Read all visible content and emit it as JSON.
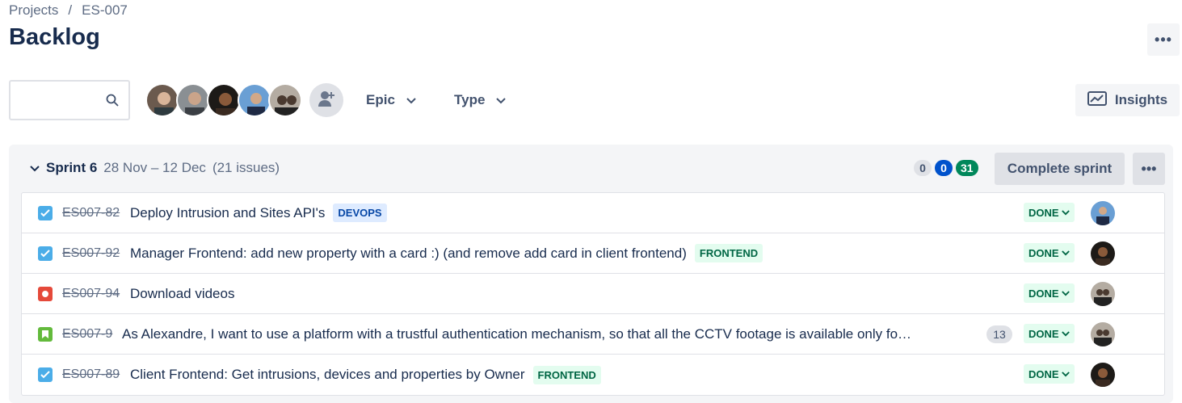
{
  "breadcrumb": {
    "projects": "Projects",
    "separator": "/",
    "project": "ES-007"
  },
  "page": {
    "title": "Backlog"
  },
  "search": {
    "placeholder": ""
  },
  "filters": {
    "epic": "Epic",
    "type": "Type"
  },
  "insights_label": "Insights",
  "sprint": {
    "name": "Sprint 6",
    "dates": "28 Nov – 12 Dec",
    "issue_count": "(21 issues)",
    "counts": {
      "todo": "0",
      "in_progress": "0",
      "done": "31"
    },
    "complete_label": "Complete sprint"
  },
  "issues": [
    {
      "type": "task",
      "key": "ES007-82",
      "summary": "Deploy Intrusion and Sites API's",
      "label": "DEVOPS",
      "status": "DONE"
    },
    {
      "type": "task",
      "key": "ES007-92",
      "summary": "Manager Frontend: add new property with a card :) (and remove add card in client frontend)",
      "label": "FRONTEND",
      "status": "DONE"
    },
    {
      "type": "bug",
      "key": "ES007-94",
      "summary": "Download videos",
      "label": "",
      "status": "DONE"
    },
    {
      "type": "story",
      "key": "ES007-9",
      "summary": "As Alexandre, I want to use a platform with a trustful authentication mechanism, so that all the CCTV footage is available only fo…",
      "label": "",
      "points": "13",
      "status": "DONE"
    },
    {
      "type": "task",
      "key": "ES007-89",
      "summary": "Client Frontend: Get intrusions, devices and properties by Owner",
      "label": "FRONTEND",
      "status": "DONE"
    }
  ],
  "colors": {
    "accent": "#0052cc",
    "done_bg": "#e3fcef",
    "done_text": "#006644",
    "bug": "#e5493a",
    "story": "#63ba3c",
    "task": "#4bade8"
  }
}
